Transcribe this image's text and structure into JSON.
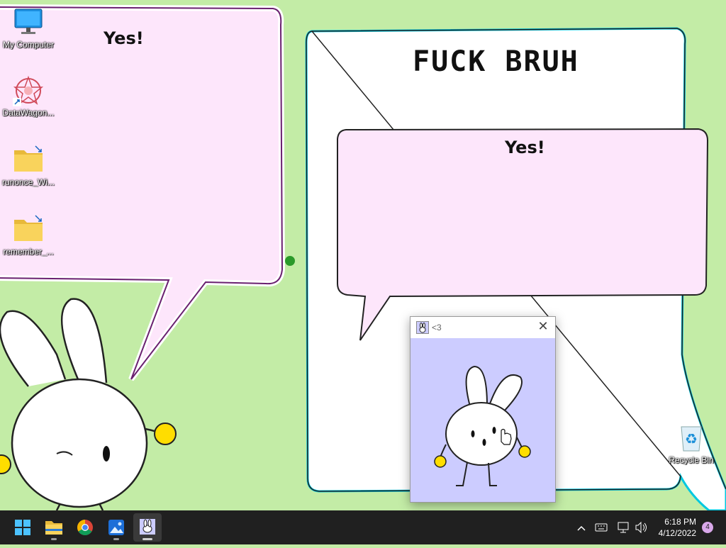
{
  "wallpaper": {
    "left_bubble_text": "Yes!",
    "poster_title": "FUCK BRUH",
    "poster_bubble_text": "Yes!"
  },
  "desktop_icons": [
    {
      "label": "My Computer",
      "icon": "monitor-icon"
    },
    {
      "label": "DataWagon...",
      "icon": "datawagon-app-icon"
    },
    {
      "label": "runonce_Wi...",
      "icon": "folder-shortcut-icon"
    },
    {
      "label": "remember_...",
      "icon": "folder-shortcut-icon"
    },
    {
      "label": "Recycle Bin",
      "icon": "recycle-bin-icon"
    }
  ],
  "app_window": {
    "title": "<3",
    "close_glyph": "✕"
  },
  "taskbar": {
    "apps": [
      {
        "name": "start",
        "icon": "windows-logo-icon"
      },
      {
        "name": "file-explorer",
        "icon": "folder-icon"
      },
      {
        "name": "chrome",
        "icon": "chrome-icon"
      },
      {
        "name": "photos",
        "icon": "photos-icon"
      },
      {
        "name": "bunny-app",
        "icon": "bunny-app-icon"
      }
    ],
    "clock_time": "6:18 PM",
    "clock_date": "4/12/2022",
    "notification_count": "4"
  },
  "colors": {
    "wallpaper_green": "#c3eca6",
    "bubble_pink": "#fde6fb",
    "window_lavender": "#ccccff",
    "taskbar": "#202020",
    "bunny_cheek_yellow": "#ffdd00"
  }
}
